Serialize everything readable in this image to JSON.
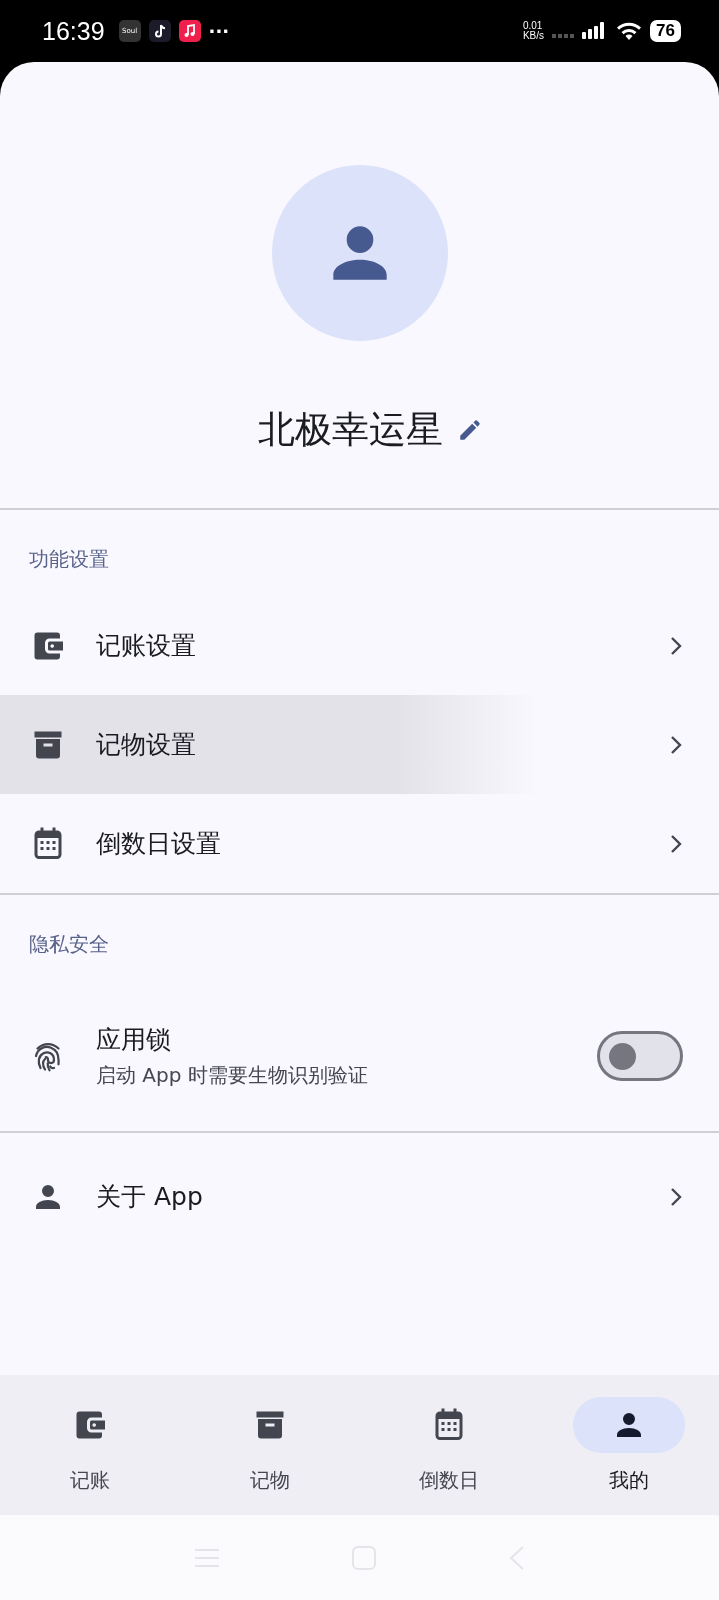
{
  "status_bar": {
    "time": "16:39",
    "app_icons": [
      {
        "kind": "soul",
        "label": "Soul"
      },
      {
        "kind": "tiktok"
      },
      {
        "kind": "music"
      }
    ],
    "more": "···",
    "net_speed": "0.01",
    "net_unit": "KB/s",
    "battery": "76"
  },
  "profile": {
    "name": "北极幸运星"
  },
  "sections": [
    {
      "title": "功能设置",
      "items": [
        {
          "kind": "link",
          "label": "记账设置",
          "highlighted": false
        },
        {
          "kind": "link",
          "label": "记物设置",
          "highlighted": true
        },
        {
          "kind": "link",
          "label": "倒数日设置",
          "highlighted": false
        }
      ]
    },
    {
      "title": "隐私安全",
      "items": [
        {
          "kind": "toggle",
          "label": "应用锁",
          "subtitle": "启动 App 时需要生物识别验证",
          "on": false,
          "highlighted": false
        }
      ]
    },
    {
      "items": [
        {
          "kind": "link",
          "label": "关于 App",
          "highlighted": false
        }
      ]
    }
  ],
  "nav": [
    {
      "label": "记账",
      "selected": false
    },
    {
      "label": "记物",
      "selected": false
    },
    {
      "label": "倒数日",
      "selected": false
    },
    {
      "label": "我的",
      "selected": true
    }
  ]
}
